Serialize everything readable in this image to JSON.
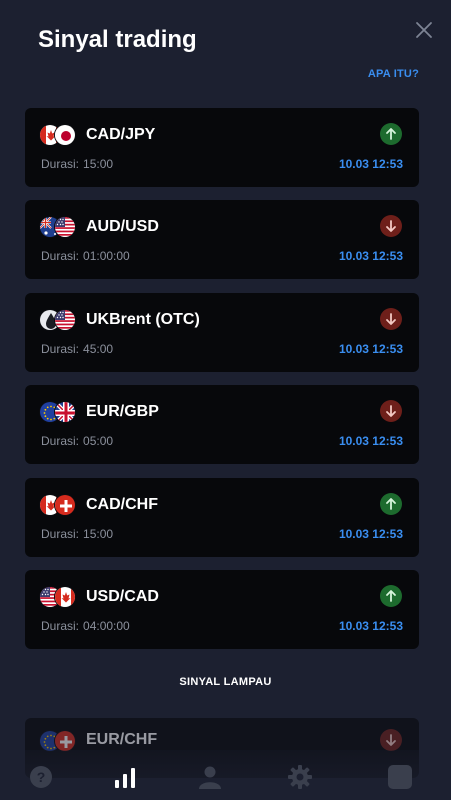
{
  "header": {
    "title": "Sinyal trading",
    "close_icon": "close-icon",
    "what_is_link": "APA ITU?"
  },
  "signals": [
    {
      "pair": "CAD/JPY",
      "flags": [
        "ca",
        "jp"
      ],
      "duration_label": "Durasi:",
      "duration": "15:00",
      "time": "10.03 12:53",
      "direction": "up"
    },
    {
      "pair": "AUD/USD",
      "flags": [
        "au",
        "us"
      ],
      "duration_label": "Durasi:",
      "duration": "01:00:00",
      "time": "10.03 12:53",
      "direction": "down"
    },
    {
      "pair": "UKBrent (OTC)",
      "flags": [
        "oil",
        "us"
      ],
      "duration_label": "Durasi:",
      "duration": "45:00",
      "time": "10.03 12:53",
      "direction": "down"
    },
    {
      "pair": "EUR/GBP",
      "flags": [
        "eu",
        "gb"
      ],
      "duration_label": "Durasi:",
      "duration": "05:00",
      "time": "10.03 12:53",
      "direction": "down"
    },
    {
      "pair": "CAD/CHF",
      "flags": [
        "ca",
        "ch"
      ],
      "duration_label": "Durasi:",
      "duration": "15:00",
      "time": "10.03 12:53",
      "direction": "up"
    },
    {
      "pair": "USD/CAD",
      "flags": [
        "us",
        "ca"
      ],
      "duration_label": "Durasi:",
      "duration": "04:00:00",
      "time": "10.03 12:53",
      "direction": "up"
    }
  ],
  "past_signals_label": "SINYAL LAMPAU",
  "past_preview": {
    "pair": "EUR/CHF",
    "flags": [
      "eu",
      "ch"
    ],
    "direction": "down"
  },
  "tabbar": {
    "items": [
      {
        "icon": "help-icon"
      },
      {
        "icon": "signals-chart-icon",
        "active": true
      },
      {
        "icon": "user-icon"
      },
      {
        "icon": "settings-icon"
      },
      {
        "icon": "square-icon"
      }
    ]
  },
  "colors": {
    "background": "#1c2030",
    "card": "#07080b",
    "accent_blue": "#3a8ef0",
    "up_green": "#1d6b2e",
    "down_red": "#6e1f1a",
    "muted_text": "#8b909c"
  }
}
